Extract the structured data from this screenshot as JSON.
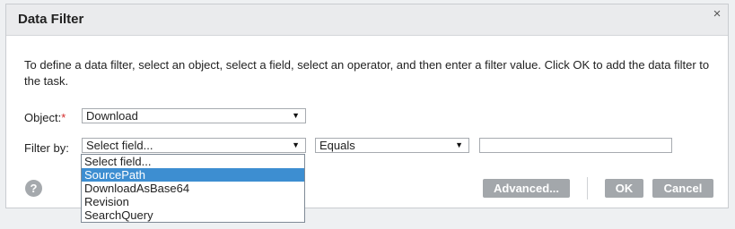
{
  "dialog": {
    "title": "Data Filter",
    "close_glyph": "×",
    "description": "To define a data filter, select an object, select a field, select an operator, and then enter a filter value. Click OK to add the data filter to the task."
  },
  "object": {
    "label": "Object:",
    "required_mark": "*",
    "value": "Download"
  },
  "filter": {
    "label": "Filter by:",
    "field_value": "Select field...",
    "operator_value": "Equals",
    "filter_value": ""
  },
  "field_options": [
    "Select field...",
    "SourcePath",
    "DownloadAsBase64",
    "Revision",
    "SearchQuery"
  ],
  "highlighted_option": "SourcePath",
  "help_glyph": "?",
  "buttons": {
    "advanced": "Advanced...",
    "ok": "OK",
    "cancel": "Cancel"
  },
  "icons": {
    "close": "close-icon",
    "help": "help-icon",
    "dropdown": "chevron-down-icon"
  },
  "colors": {
    "highlight": "#3d8ed1",
    "button": "#a3a7ab",
    "required": "#d42a2a",
    "titlebar": "#eaebed"
  }
}
